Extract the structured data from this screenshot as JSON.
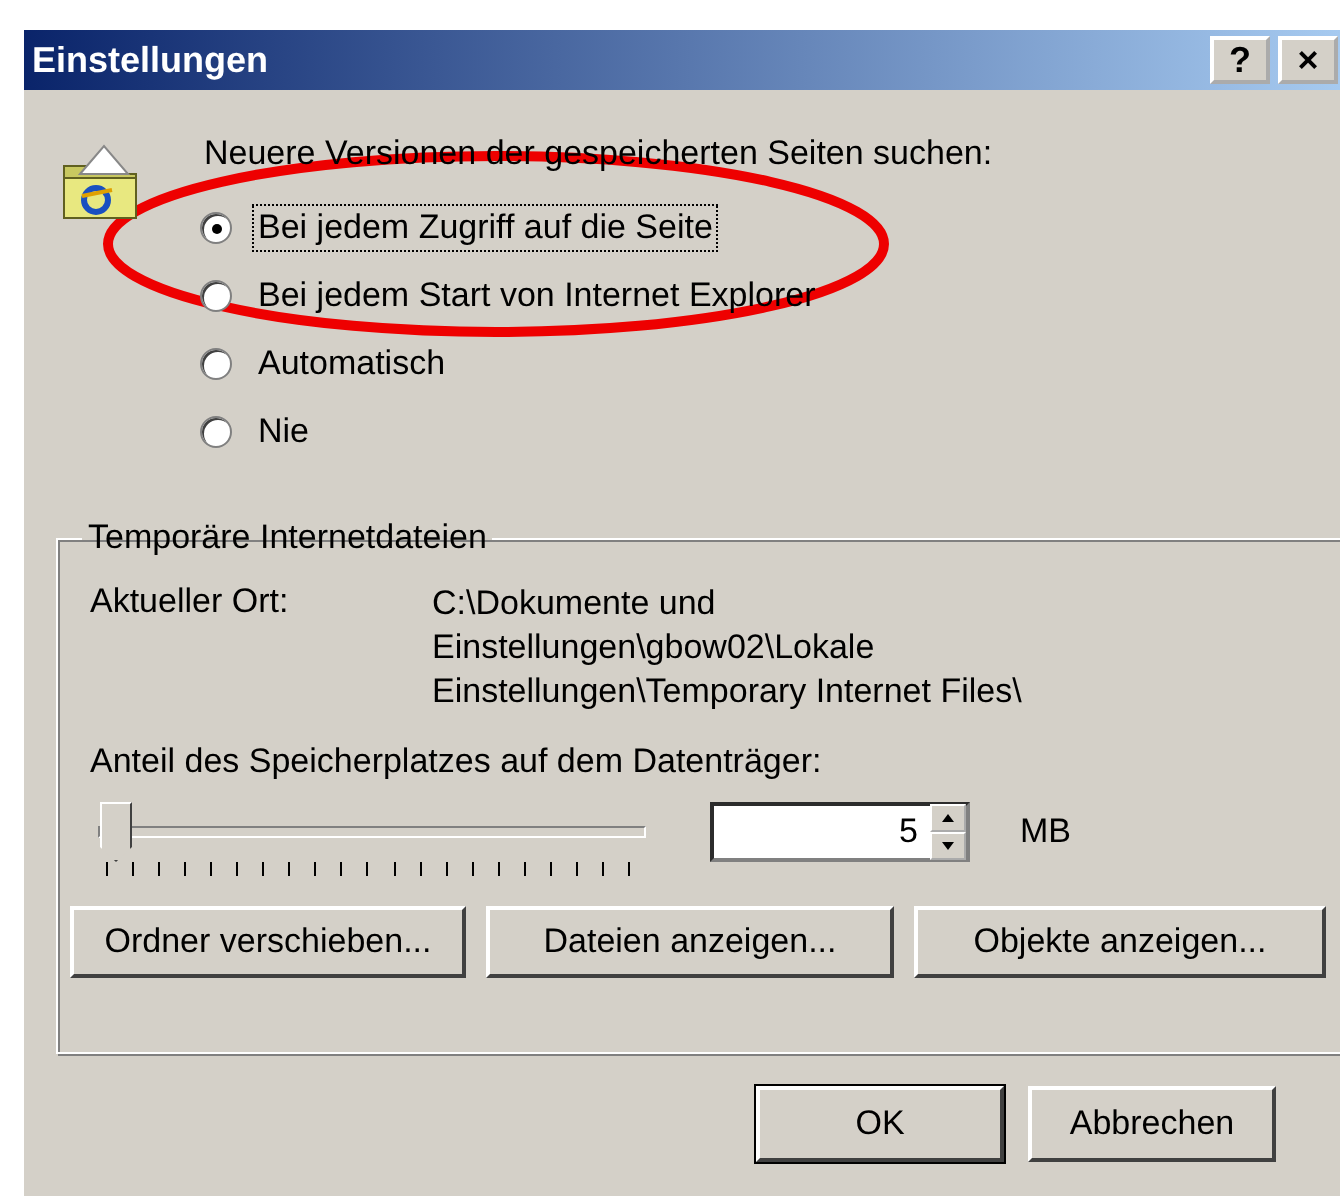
{
  "window": {
    "title": "Einstellungen",
    "title_buttons": [
      "?",
      "×"
    ]
  },
  "check_newer": {
    "heading": "Neuere Versionen der gespeicherten Seiten suchen:",
    "options": [
      {
        "label": "Bei jedem Zugriff auf die Seite",
        "selected": true
      },
      {
        "label": "Bei jedem Start von Internet Explorer",
        "selected": false
      },
      {
        "label": "Automatisch",
        "selected": false
      },
      {
        "label": "Nie",
        "selected": false
      }
    ]
  },
  "temp_files": {
    "title": "Temporäre Internetdateien",
    "location_label": "Aktueller Ort:",
    "location_lines": [
      "C:\\Dokumente und",
      "Einstellungen\\gbow02\\Lokale",
      "Einstellungen\\Temporary Internet Files\\"
    ],
    "space_label": "Anteil des Speicherplatzes auf dem Datenträger:",
    "slider": {
      "level": 0
    },
    "size_value": "5",
    "size_unit": "MB",
    "buttons": [
      "Ordner verschieben...",
      "Dateien anzeigen...",
      "Objekte anzeigen..."
    ]
  },
  "buttons": [
    {
      "label": "OK",
      "default": true
    },
    {
      "label": "Abbrechen",
      "default": false
    }
  ]
}
